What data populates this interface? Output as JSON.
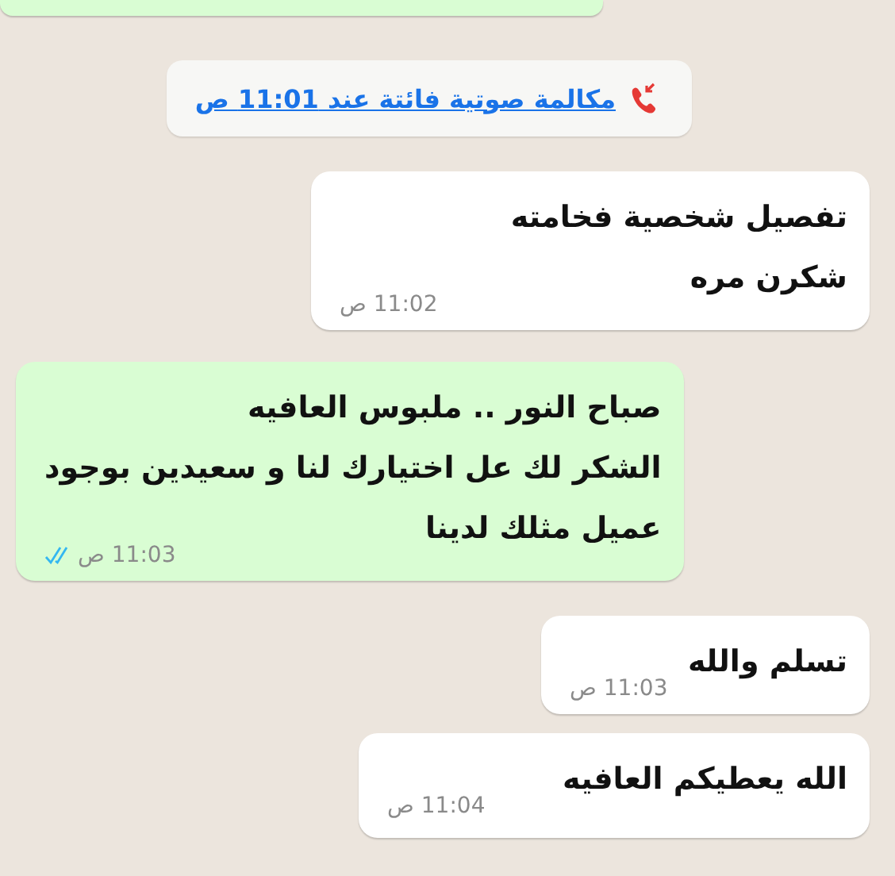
{
  "messages": [
    {
      "kind": "call",
      "text": "مكالمة صوتية فائتة عند 11:01 ص"
    },
    {
      "kind": "incoming",
      "lines": [
        "تفصيل شخصية فخامته",
        "شكرن مره"
      ],
      "time": "11:02 ص"
    },
    {
      "kind": "outgoing",
      "lines": [
        "صباح النور .. ملبوس العافيه",
        "الشكر لك عل اختيارك لنا و سعيدين بوجود",
        "عميل مثلك لدينا"
      ],
      "time": "11:03 ص",
      "read": true
    },
    {
      "kind": "incoming",
      "lines": [
        "تسلم والله"
      ],
      "time": "11:03 ص"
    },
    {
      "kind": "incoming",
      "lines": [
        "الله يعطيكم العافيه"
      ],
      "time": "11:04 ص"
    }
  ]
}
